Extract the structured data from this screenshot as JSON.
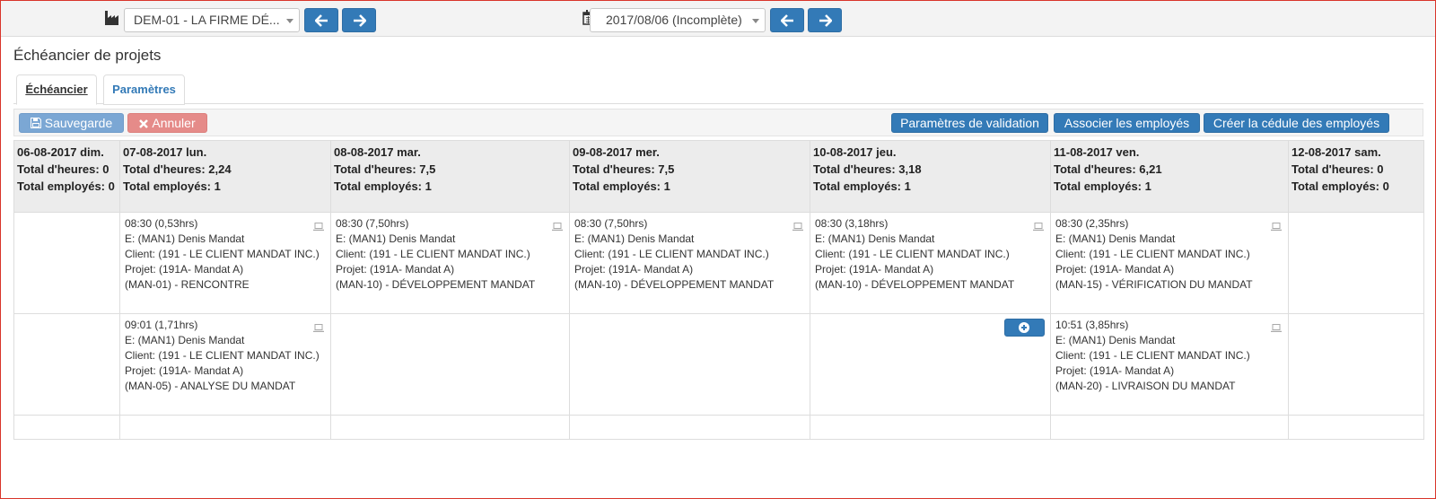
{
  "topbar": {
    "company_select": "DEM-01 - LA FIRME DÉ...",
    "period_select": "2017/08/06 (Incomplète)",
    "icons": {
      "company": "factory-icon",
      "period": "calendar-icon",
      "prev": "arrow-left-icon",
      "next": "arrow-right-icon"
    }
  },
  "page": {
    "title": "Échéancier de projets"
  },
  "tabs": [
    {
      "label": "Échéancier",
      "active": true
    },
    {
      "label": "Paramètres",
      "active": false
    }
  ],
  "toolbar": {
    "save_label": "Sauvegarde",
    "cancel_label": "Annuler",
    "validation_label": "Paramètres de validation",
    "associate_label": "Associer les employés",
    "create_label": "Créer la cédule des employés"
  },
  "days": [
    {
      "date": "06-08-2017 dim.",
      "hours": "Total d'heures: 0",
      "employees": "Total employés: 0"
    },
    {
      "date": "07-08-2017 lun.",
      "hours": "Total d'heures: 2,24",
      "employees": "Total employés: 1"
    },
    {
      "date": "08-08-2017 mar.",
      "hours": "Total d'heures: 7,5",
      "employees": "Total employés: 1"
    },
    {
      "date": "09-08-2017 mer.",
      "hours": "Total d'heures: 7,5",
      "employees": "Total employés: 1"
    },
    {
      "date": "10-08-2017 jeu.",
      "hours": "Total d'heures: 3,18",
      "employees": "Total employés: 1"
    },
    {
      "date": "11-08-2017 ven.",
      "hours": "Total d'heures: 6,21",
      "employees": "Total employés: 1"
    },
    {
      "date": "12-08-2017 sam.",
      "hours": "Total d'heures: 0",
      "employees": "Total employés: 0"
    }
  ],
  "rows": [
    [
      null,
      {
        "time": "08:30 (0,53hrs)",
        "employee": "E: (MAN1) Denis Mandat",
        "client": "Client: (191 - LE CLIENT MANDAT INC.)",
        "project": "Projet: (191A- Mandat A)",
        "task": "(MAN-01) - RENCONTRE"
      },
      {
        "time": "08:30 (7,50hrs)",
        "employee": "E: (MAN1) Denis Mandat",
        "client": "Client: (191 - LE CLIENT MANDAT INC.)",
        "project": "Projet: (191A- Mandat A)",
        "task": "(MAN-10) - DÉVELOPPEMENT MANDAT"
      },
      {
        "time": "08:30 (7,50hrs)",
        "employee": "E: (MAN1) Denis Mandat",
        "client": "Client: (191 - LE CLIENT MANDAT INC.)",
        "project": "Projet: (191A- Mandat A)",
        "task": "(MAN-10) - DÉVELOPPEMENT MANDAT"
      },
      {
        "time": "08:30 (3,18hrs)",
        "employee": "E: (MAN1) Denis Mandat",
        "client": "Client: (191 - LE CLIENT MANDAT INC.)",
        "project": "Projet: (191A- Mandat A)",
        "task": "(MAN-10) - DÉVELOPPEMENT MANDAT"
      },
      {
        "time": "08:30 (2,35hrs)",
        "employee": "E: (MAN1) Denis Mandat",
        "client": "Client: (191 - LE CLIENT MANDAT INC.)",
        "project": "Projet: (191A- Mandat A)",
        "task": "(MAN-15) - VÉRIFICATION DU MANDAT"
      },
      null
    ],
    [
      null,
      {
        "time": "09:01 (1,71hrs)",
        "employee": "E: (MAN1) Denis Mandat",
        "client": "Client: (191 - LE CLIENT MANDAT INC.)",
        "project": "Projet: (191A- Mandat A)",
        "task": "(MAN-05) - ANALYSE DU MANDAT"
      },
      null,
      null,
      {
        "add": true
      },
      {
        "time": "10:51 (3,85hrs)",
        "employee": "E: (MAN1) Denis Mandat",
        "client": "Client: (191 - LE CLIENT MANDAT INC.)",
        "project": "Projet: (191A- Mandat A)",
        "task": "(MAN-20) - LIVRAISON DU MANDAT"
      },
      null
    ]
  ],
  "colors": {
    "primary": "#337ab7",
    "save_disabled": "#7ba7d4",
    "cancel_disabled": "#e58b89",
    "header_bg": "#ececec",
    "frame_border": "#d9342b"
  }
}
